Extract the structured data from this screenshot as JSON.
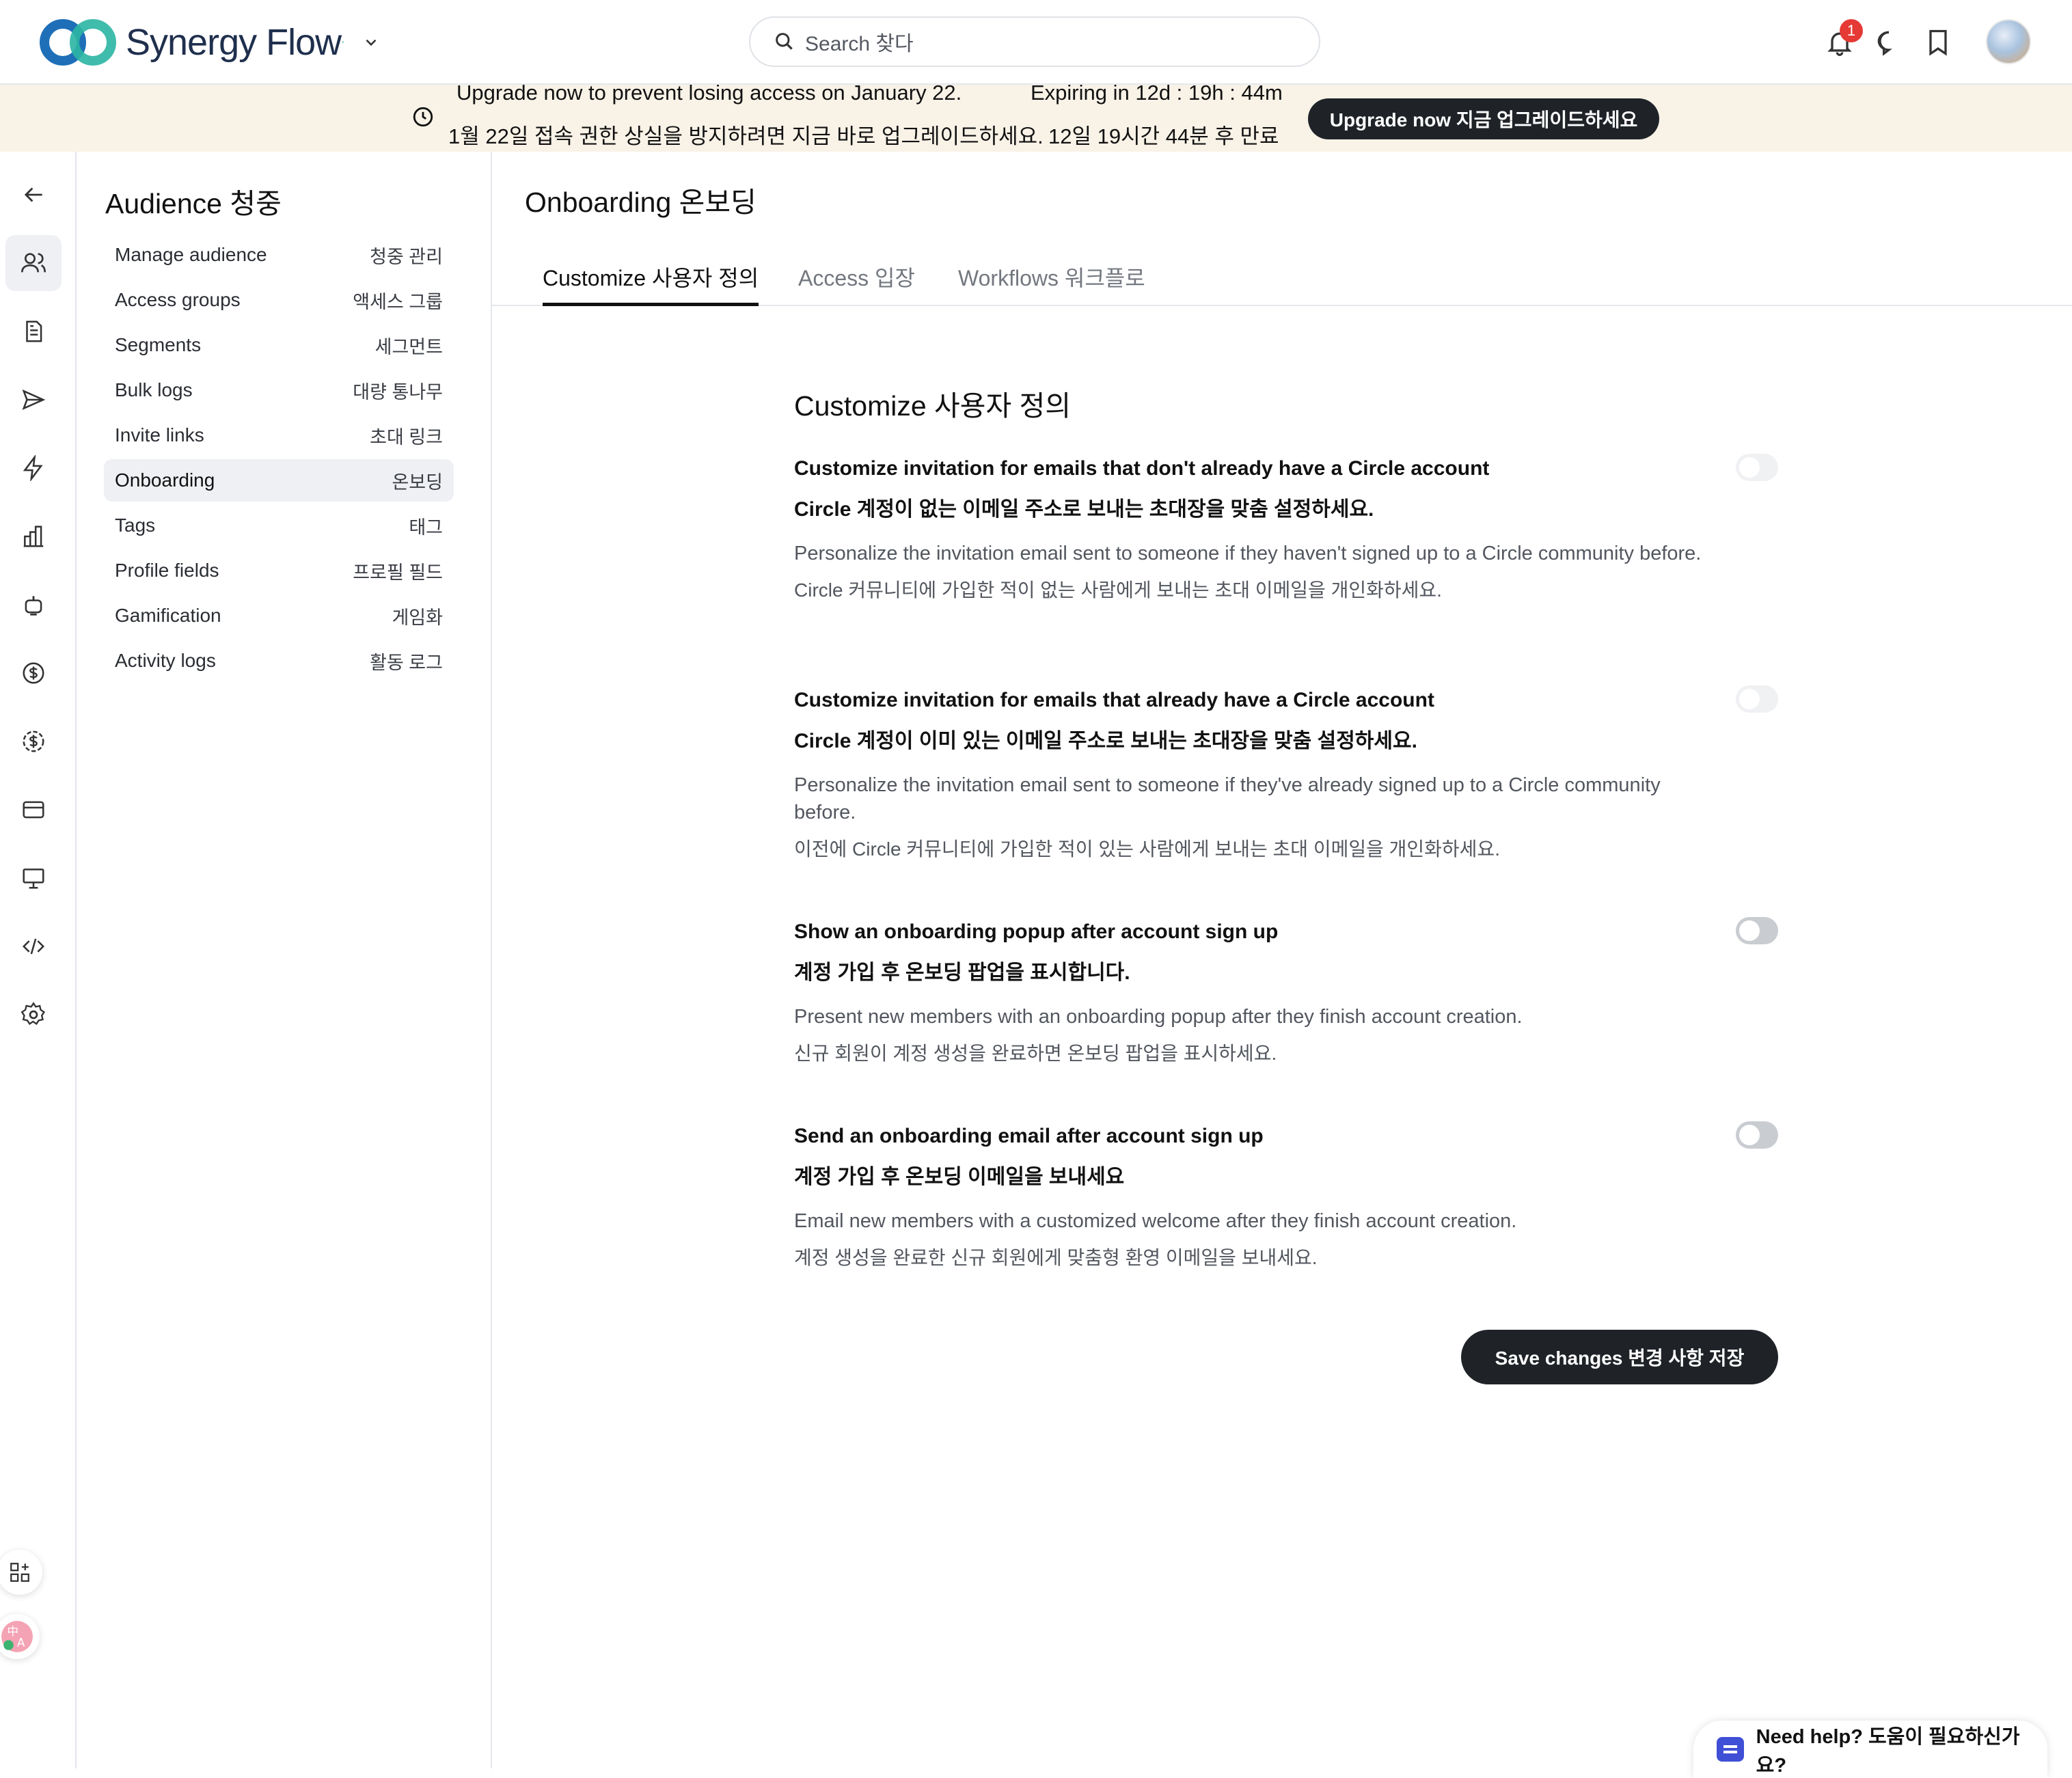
{
  "header": {
    "brand": "Synergy Flow",
    "search_placeholder": "Search 찾다",
    "notification_count": "1"
  },
  "banner": {
    "message_en": "Upgrade now to prevent losing access on January 22.",
    "expiry_en": "Expiring in 12d : 19h : 44m",
    "message_ko": "1월 22일 접속 권한 상실을 방지하려면 지금 바로 업그레이드하세요.",
    "expiry_ko": "12일 19시간 44분 후 만료",
    "button": "Upgrade now 지금 업그레이드하세요"
  },
  "rail": {
    "icons": [
      "back-arrow-icon",
      "users-icon",
      "document-icon",
      "send-icon",
      "bolt-icon",
      "bar-chart-icon",
      "bot-icon",
      "dollar-icon",
      "dollar-badge-icon",
      "card-icon",
      "monitor-icon",
      "code-icon",
      "gear-icon"
    ],
    "active_index": 1
  },
  "subnav": {
    "title": "Audience 청중",
    "items": [
      {
        "en": "Manage audience",
        "ko": "청중 관리"
      },
      {
        "en": "Access groups",
        "ko": "액세스 그룹"
      },
      {
        "en": "Segments",
        "ko": "세그먼트"
      },
      {
        "en": "Bulk logs",
        "ko": "대량 통나무"
      },
      {
        "en": "Invite links",
        "ko": "초대 링크"
      },
      {
        "en": "Onboarding",
        "ko": "온보딩"
      },
      {
        "en": "Tags",
        "ko": "태그"
      },
      {
        "en": "Profile fields",
        "ko": "프로필 필드"
      },
      {
        "en": "Gamification",
        "ko": "게임화"
      },
      {
        "en": "Activity logs",
        "ko": "활동 로그"
      }
    ],
    "active_index": 5
  },
  "main": {
    "title": "Onboarding 온보딩",
    "tabs": [
      {
        "label": "Customize 사용자 정의",
        "active": true
      },
      {
        "label": "Access 입장",
        "active": false
      },
      {
        "label": "Workflows 워크플로",
        "active": false
      }
    ],
    "section_title": "Customize 사용자 정의",
    "settings": [
      {
        "title": "Customize invitation for emails that don't already have a Circle account",
        "title_ko": "Circle 계정이 없는 이메일 주소로 보내는 초대장을 맞춤 설정하세요.",
        "desc": "Personalize the invitation email sent to someone if they haven't signed up to a Circle community before.",
        "desc_ko": "Circle 커뮤니티에 가입한 적이 없는 사람에게 보내는 초대 이메일을 개인화하세요.",
        "enabled": false
      },
      {
        "title": "Customize invitation for emails that already have a Circle account",
        "title_ko": "Circle 계정이 이미 있는 이메일 주소로 보내는 초대장을 맞춤 설정하세요.",
        "desc": "Personalize the invitation email sent to someone if they've already signed up to a Circle community before.",
        "desc_ko": "이전에 Circle 커뮤니티에 가입한 적이 있는 사람에게 보내는 초대 이메일을 개인화하세요.",
        "enabled": false
      },
      {
        "title": "Show an onboarding popup after account sign up",
        "title_ko": "계정 가입 후 온보딩 팝업을 표시합니다.",
        "desc": "Present new members with an onboarding popup after they finish account creation.",
        "desc_ko": "신규 회원이 계정 생성을 완료하면 온보딩 팝업을 표시하세요.",
        "enabled": false
      },
      {
        "title": "Send an onboarding email after account sign up",
        "title_ko": "계정 가입 후 온보딩 이메일을 보내세요",
        "desc": "Email new members with a customized welcome after they finish account creation.",
        "desc_ko": "계정 생성을 완료한 신규 회원에게 맞춤형 환영 이메일을 보내세요.",
        "enabled": false
      }
    ],
    "save_button": "Save changes 변경 사항 저장"
  },
  "help": {
    "label": "Need help? 도움이 필요하신가요?"
  },
  "colors": {
    "dark_button": "#1f2328",
    "banner_bg": "#f8f2e7",
    "badge": "#e53935",
    "help_icon": "#3f4fd6"
  }
}
